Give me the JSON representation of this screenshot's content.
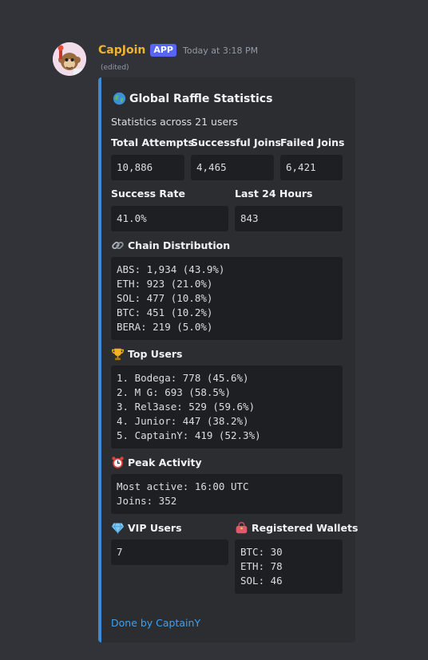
{
  "message": {
    "username": "CapJoin",
    "badge": "APP",
    "timestamp": "Today at 3:18 PM",
    "edited": "(edited)"
  },
  "embed": {
    "accent_color": "#3b8bd6",
    "title": "Global Raffle Statistics",
    "title_icon": "globe-icon",
    "description": "Statistics across 21 users",
    "fields": {
      "total_attempts": {
        "name": "Total Attempts",
        "value": "10,886"
      },
      "successful_joins": {
        "name": "Successful Joins",
        "value": "4,465"
      },
      "failed_joins": {
        "name": "Failed Joins",
        "value": "6,421"
      },
      "success_rate": {
        "name": "Success Rate",
        "value": "41.0%"
      },
      "last_24_hours": {
        "name": "Last 24 Hours",
        "value": "843"
      },
      "chain_distribution": {
        "name": "Chain Distribution",
        "icon": "link-icon",
        "lines": [
          "ABS: 1,934 (43.9%)",
          "ETH: 923 (21.0%)",
          "SOL: 477 (10.8%)",
          "BTC: 451 (10.2%)",
          "BERA: 219 (5.0%)"
        ]
      },
      "top_users": {
        "name": "Top Users",
        "icon": "trophy-icon",
        "lines": [
          "1. Bodega: 778 (45.6%)",
          "2. M G: 693 (58.5%)",
          "3. Rel3ase: 529 (59.6%)",
          "4. Junior: 447 (38.2%)",
          "5. CaptainY: 419 (52.3%)"
        ]
      },
      "peak_activity": {
        "name": "Peak Activity",
        "icon": "alarm-clock-icon",
        "lines": [
          "Most active: 16:00 UTC",
          "Joins: 352"
        ]
      },
      "vip_users": {
        "name": "VIP Users",
        "icon": "gem-icon",
        "value": "7"
      },
      "registered_wallets": {
        "name": "Registered Wallets",
        "icon": "purse-icon",
        "lines": [
          "BTC: 30",
          "ETH: 78",
          "SOL: 46"
        ]
      }
    },
    "footer": "Done by CaptainY"
  }
}
